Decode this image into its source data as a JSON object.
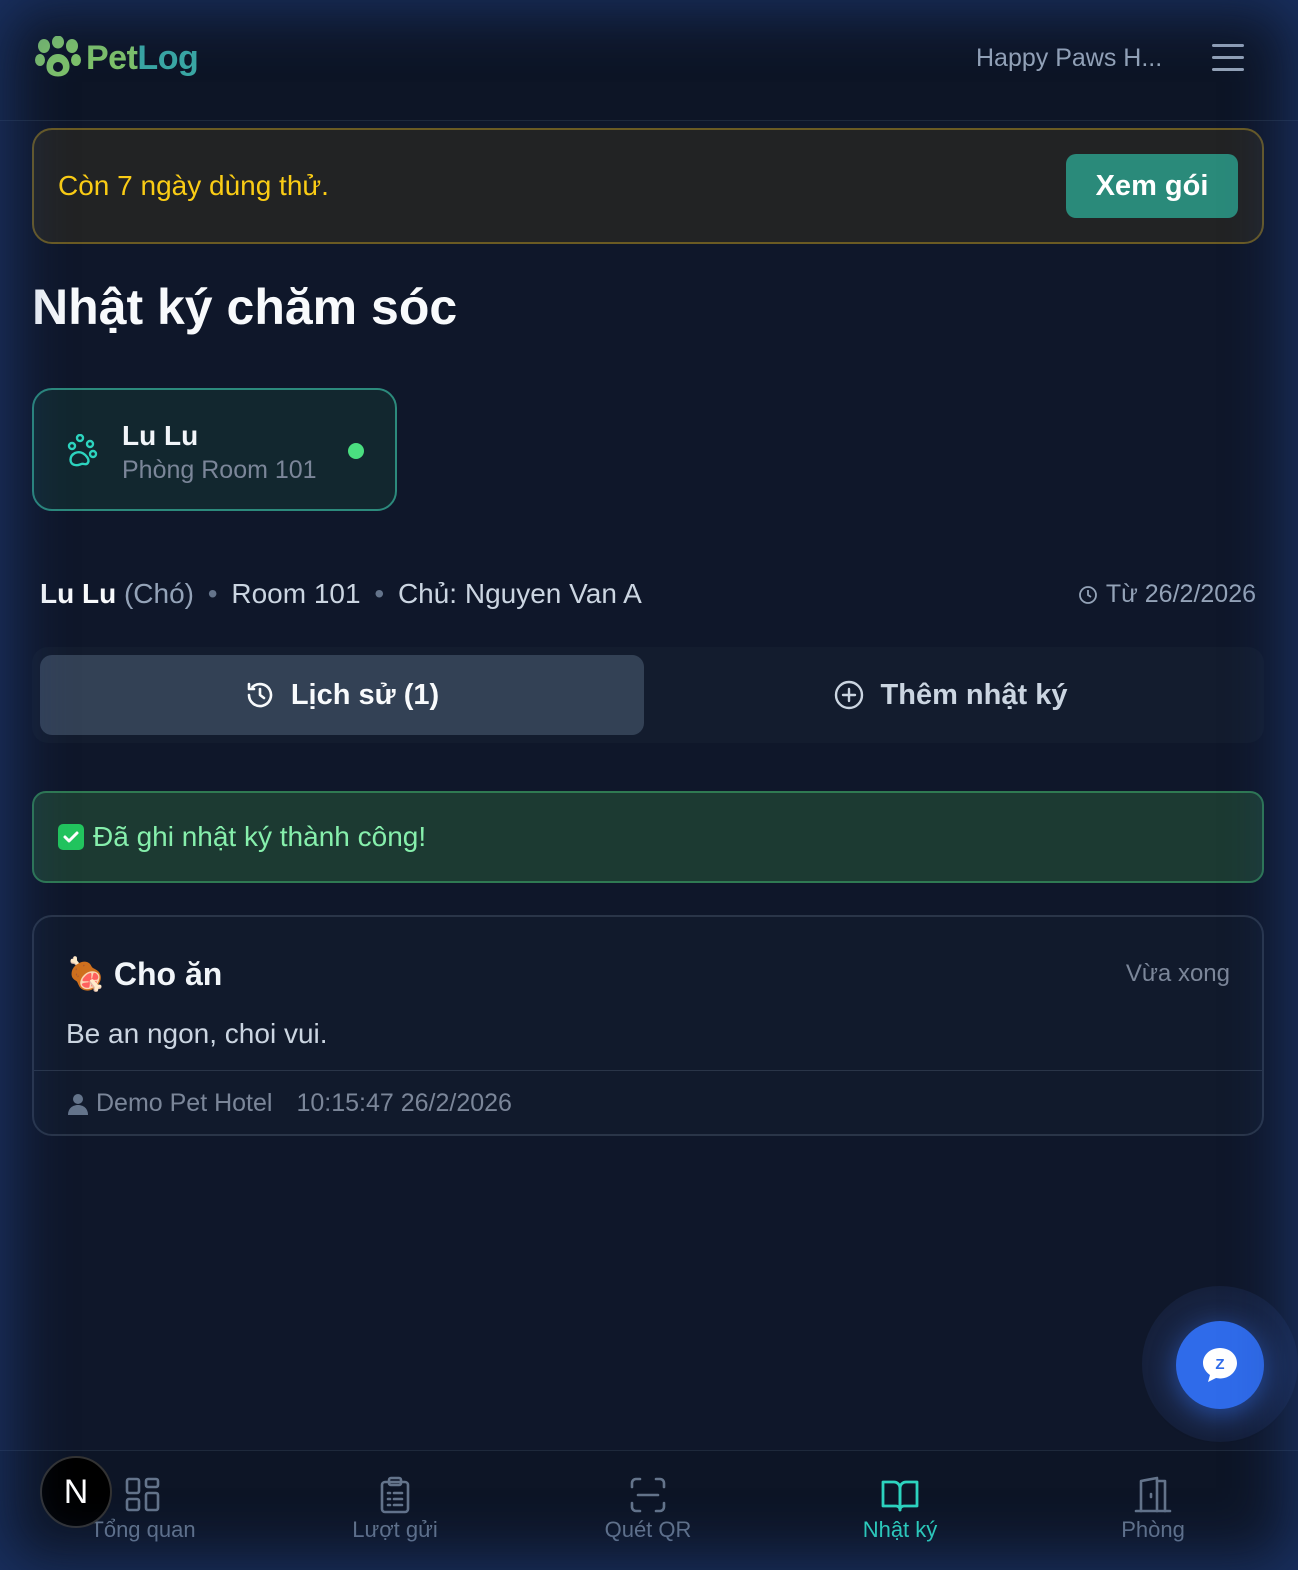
{
  "header": {
    "logo_part1": "Pet",
    "logo_part2": "Log",
    "hotel_name": "Happy Paws H..."
  },
  "trial": {
    "text": "Còn 7 ngày dùng thử.",
    "button": "Xem gói"
  },
  "page_title": "Nhật ký chăm sóc",
  "pet_card": {
    "name": "Lu Lu",
    "room": "Phòng Room 101"
  },
  "info": {
    "name": "Lu Lu",
    "species": "(Chó)",
    "room": "Room 101",
    "owner": "Chủ: Nguyen Van A",
    "since": "Từ 26/2/2026"
  },
  "tabs": {
    "history": "Lịch sử (1)",
    "add": "Thêm nhật ký"
  },
  "success_message": "Đã ghi nhật ký thành công!",
  "entry": {
    "emoji": "🍖",
    "title": "Cho ăn",
    "time": "Vừa xong",
    "note": "Be an ngon, choi vui.",
    "author": "Demo Pet Hotel",
    "timestamp": "10:15:47 26/2/2026"
  },
  "chat": {
    "icon": "zalo-chat-icon"
  },
  "avatar_letter": "N",
  "bottom_nav": [
    {
      "label": "Tổng quan",
      "icon": "dashboard-icon"
    },
    {
      "label": "Lượt gửi",
      "icon": "clipboard-icon"
    },
    {
      "label": "Quét QR",
      "icon": "scan-icon"
    },
    {
      "label": "Nhật ký",
      "icon": "book-icon",
      "active": true
    },
    {
      "label": "Phòng",
      "icon": "door-icon"
    }
  ],
  "colors": {
    "background": "#0f172a",
    "accent": "#2dd4bf",
    "trial_text": "#facc15",
    "success_text": "#86efac",
    "chat_button": "#2f6bea"
  }
}
